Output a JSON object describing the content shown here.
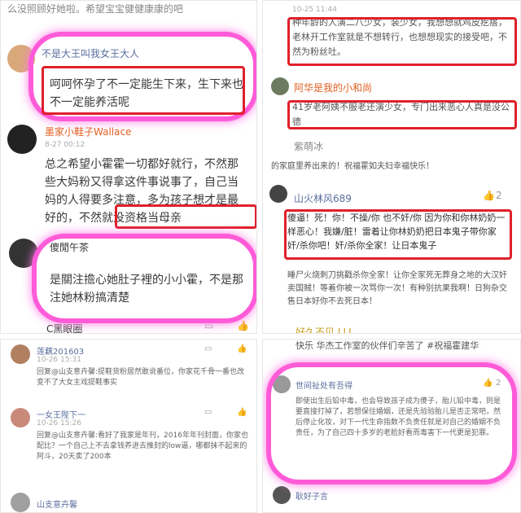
{
  "tl": {
    "top_text": "么没照顾好她啦。希望宝宝健健康康的吧",
    "u1_name": "不是大王叫我女王大人",
    "u1_comment": "呵呵怀孕了不一定能生下来，生下来也不一定能养活呢",
    "u2_name": "墨家小鞋子Wallace",
    "u2_time": "8-27 00:12",
    "u2_comment": "总之希望小霍霍一切都好就行，不然那些大妈粉又得拿这件事说事了，自己当妈的人得要多注意，多为孩子想才是最好的，不然就没资格当母亲",
    "u3_name": "傻閒午茶",
    "u3_comment": "是關注擔心她肚子裡的小小霍，不是那注她林粉搞清楚",
    "u4_name": "C黑眼圈"
  },
  "tr": {
    "top_time": "10-25 11:44",
    "comment1": "种年龄的人演二八少女，装少女，我想想就鸡皮疙瘩，老林开工作室就是不想转行，也想想现实的接受吧，不然为粉丝吐。",
    "u2_name": "阿华是我的小和尚",
    "comment2": "41岁老阿姨不服老还演少女，专门出来恶心人真是没公德",
    "u3_name": "紫萌冰",
    "comment3": "的家庭里养出来的！祝福霍如夫妇幸福快乐！",
    "u4_name": "山火林风689",
    "u4_like": "2",
    "comment4": "傻逼！死！你！不操/你 也不奸/你 因为你和你林奶奶一样恶心！我嫌/脏！雷着让你林奶奶把日本鬼子带你家奸/杀你吧！奸/杀你全家！让日本鬼子",
    "comment4_more": "睡尸火烧刺刀挑戳杀你全家！让你全家死无葬身之地的大汉奸卖国贼！等着你被一次骂你一次！有种别抗果我啊！日狗杂交售日本好你不去死日本！",
    "u5_name": "好久不见 LLL",
    "bottom": "快乐 华杰工作室的伙伴们辛苦了 #祝福霍建华"
  },
  "bl": {
    "u1_name": "莲藕201603",
    "u1_time": "10-26 15:31",
    "u1_reply": "回复@山支意卉馨:提鞋货粉居然敢说番位，你家花千骨一番也改变不了大女主戏提鞋事实",
    "u2_name": "一女王陛下一",
    "u2_time": "10-26 15:26",
    "u2_reply": "回复@山支意卉馨:看好了我家是年刊，2016年年刊封面，你家也配比？一个自己上不去拿钱养进去推封的low逼，哪都抹不起来的阿斗，20天卖了200本",
    "u3_name": "山支意卉馨"
  },
  "br": {
    "u1_name": "世间祉处有吾得",
    "u1_like": "2",
    "u1_comment": "即使出生后铅中毒，也会导致孩子成为傻子，胎儿铅中毒，则是要直接打掉了，若想保住婚姻，还是先验验胎儿是否正常吧，然后停止化妆，对下一代生命指数不负责任就是对自己的婚姻不负责任，为了自己四十多岁的老脸好看而毒害下一代更是犯罪。",
    "u2_name": "耿好子言"
  },
  "colors": {
    "highlight": "#ff5bd8",
    "box": "#e0202a",
    "username": "#5a6f9e"
  }
}
